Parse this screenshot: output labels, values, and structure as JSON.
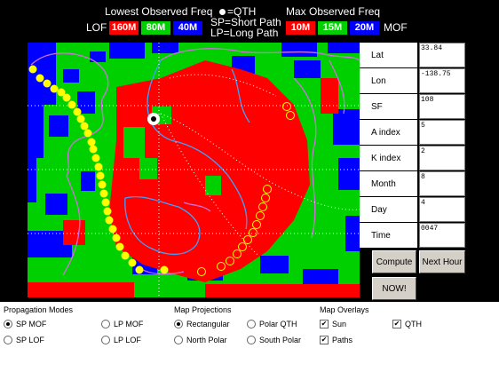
{
  "legend": {
    "lowest_title": "Lowest Observed Freq",
    "qth_key": "=QTH",
    "max_title": "Max Observed Freq",
    "sp_key": "SP=Short Path",
    "lp_key": "LP=Long Path",
    "lof_label": "LOF",
    "mof_label": "MOF",
    "lof_bands": [
      {
        "label": "160M",
        "color": "#ff0000"
      },
      {
        "label": "80M",
        "color": "#00d000"
      },
      {
        "label": "40M",
        "color": "#0000ff"
      }
    ],
    "mof_bands": [
      {
        "label": "10M",
        "color": "#ff0000"
      },
      {
        "label": "15M",
        "color": "#00d000"
      },
      {
        "label": "20M",
        "color": "#0000ff"
      }
    ]
  },
  "fields": [
    {
      "label": "Lat",
      "value": "33.84"
    },
    {
      "label": "Lon",
      "value": "-138.75"
    },
    {
      "label": "SF",
      "value": "108"
    },
    {
      "label": "A index",
      "value": "5"
    },
    {
      "label": "K index",
      "value": "2"
    },
    {
      "label": "Month",
      "value": "8"
    },
    {
      "label": "Day",
      "value": "4"
    },
    {
      "label": "Time",
      "value": "0047"
    }
  ],
  "buttons": {
    "compute": "Compute",
    "next_hour": "Next Hour",
    "now": "NOW!"
  },
  "panel": {
    "propagation": {
      "title": "Propagation Modes",
      "options": [
        {
          "label": "SP MOF",
          "selected": true
        },
        {
          "label": "LP MOF",
          "selected": false
        },
        {
          "label": "SP LOF",
          "selected": false
        },
        {
          "label": "LP LOF",
          "selected": false
        }
      ]
    },
    "projections": {
      "title": "Map Projections",
      "options": [
        {
          "label": "Rectangular",
          "selected": true
        },
        {
          "label": "Polar QTH",
          "selected": false
        },
        {
          "label": "North Polar",
          "selected": false
        },
        {
          "label": "South Polar",
          "selected": false
        }
      ]
    },
    "overlays": {
      "title": "Map Overlays",
      "options": [
        {
          "label": "Sun",
          "checked": true
        },
        {
          "label": "QTH",
          "checked": true
        },
        {
          "label": "Paths",
          "checked": true
        }
      ]
    }
  },
  "colors": {
    "red": "#ff0000",
    "green": "#00d000",
    "blue": "#0000ff",
    "coast_land": "#d070e0",
    "coast_water": "#40a0ff",
    "path_yellow": "#ffff00"
  }
}
